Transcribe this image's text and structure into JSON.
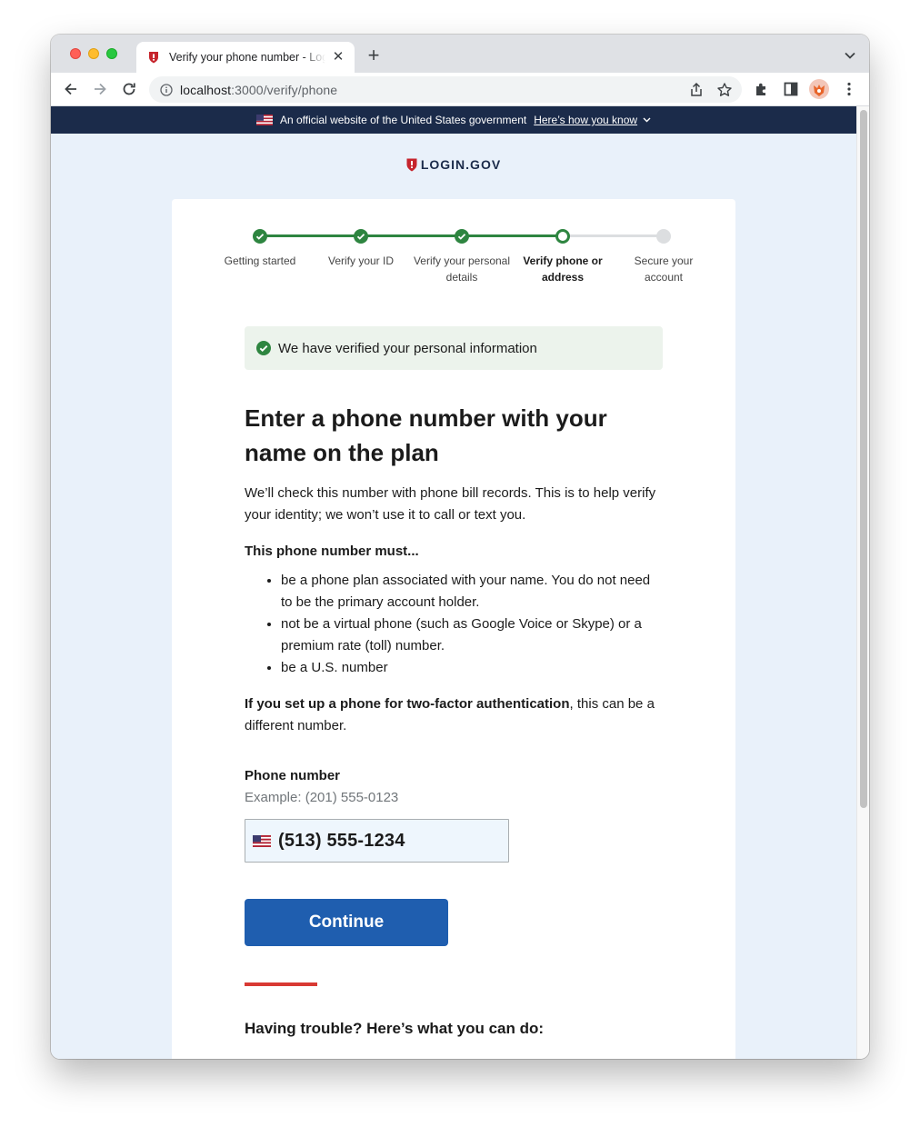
{
  "browser": {
    "tab_title": "Verify your phone number - Login.gov",
    "url_host": "localhost",
    "url_path": ":3000/verify/phone"
  },
  "gov_banner": {
    "text": "An official website of the United States government",
    "link": "Here’s how you know"
  },
  "logo": {
    "text": "LOGIN.GOV"
  },
  "steps": [
    {
      "label": "Getting started",
      "status": "done"
    },
    {
      "label": "Verify your ID",
      "status": "done"
    },
    {
      "label": "Verify your personal details",
      "status": "done"
    },
    {
      "label": "Verify phone or address",
      "status": "current"
    },
    {
      "label": "Secure your account",
      "status": "todo"
    }
  ],
  "alert": {
    "text": "We have verified your personal information"
  },
  "main": {
    "title": "Enter a phone number with your name on the plan",
    "intro": "We’ll check this number with phone bill records. This is to help verify your identity; we won’t use it to call or text you.",
    "must_heading": "This phone number must...",
    "rules": [
      "be a phone plan associated with your name. You do not need to be the primary account holder.",
      "not be a virtual phone (such as Google Voice or Skype) or a premium rate (toll) number.",
      "be a U.S. number"
    ],
    "twofactor_bold": "If you set up a phone for two-factor authentication",
    "twofactor_rest": ", this can be a different number."
  },
  "phone_field": {
    "label": "Phone number",
    "hint": "Example: (201) 555-0123",
    "value": "(513) 555-1234"
  },
  "continue_label": "Continue",
  "trouble_heading": "Having trouble? Here’s what you can do:",
  "colors": {
    "navy": "#1b2b4a",
    "success_green": "#2e8540",
    "primary_blue": "#1f5eaf",
    "accent_red": "#d83933",
    "page_bg": "#e9f1fa"
  }
}
